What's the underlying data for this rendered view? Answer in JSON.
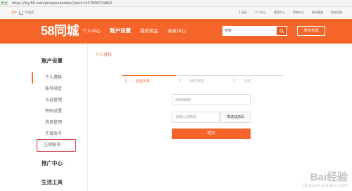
{
  "browser": {
    "security_label": "安全",
    "url": "https://my.58.com/pro/persondata/?pts=1537848719862"
  },
  "topbar": {
    "city": "北京",
    "home": "58首页",
    "links": [
      "1 退出",
      "个人中心",
      "商家中心",
      "帮助中心",
      "联系客服",
      "网站导航"
    ]
  },
  "header": {
    "logo": "58同城",
    "nav": [
      "个人中心",
      "账户设置",
      "我的资金",
      "商家中心"
    ],
    "active_nav": "账户设置",
    "search_placeholder": "搜索",
    "post_button": "发布信息"
  },
  "sidebar": {
    "title": "账户设置",
    "items": [
      "个人资料",
      "账号绑定",
      "认证管理",
      "密码设置",
      "消息管理",
      "子母账号",
      "注销账号"
    ],
    "active_item": "个人资料",
    "groups": [
      {
        "label": "推广中心",
        "chevron": "›"
      },
      {
        "label": "生活工具"
      }
    ]
  },
  "main": {
    "breadcrumb": "个人资料",
    "steps": [
      {
        "num": "1",
        "label": "验证手机"
      },
      {
        "num": "2",
        "label": "绑定邮箱"
      },
      {
        "num": "3",
        "label": "完成"
      }
    ],
    "code_placeholder": "请输入动态码",
    "send_code_button": "发送动态码",
    "submit_button": "提交"
  },
  "watermark": {
    "main": "Bai经验",
    "sub": "jingyan.baidu.com"
  },
  "colors": {
    "brand": "#f5652a",
    "highlight_border": "#d0202a"
  }
}
